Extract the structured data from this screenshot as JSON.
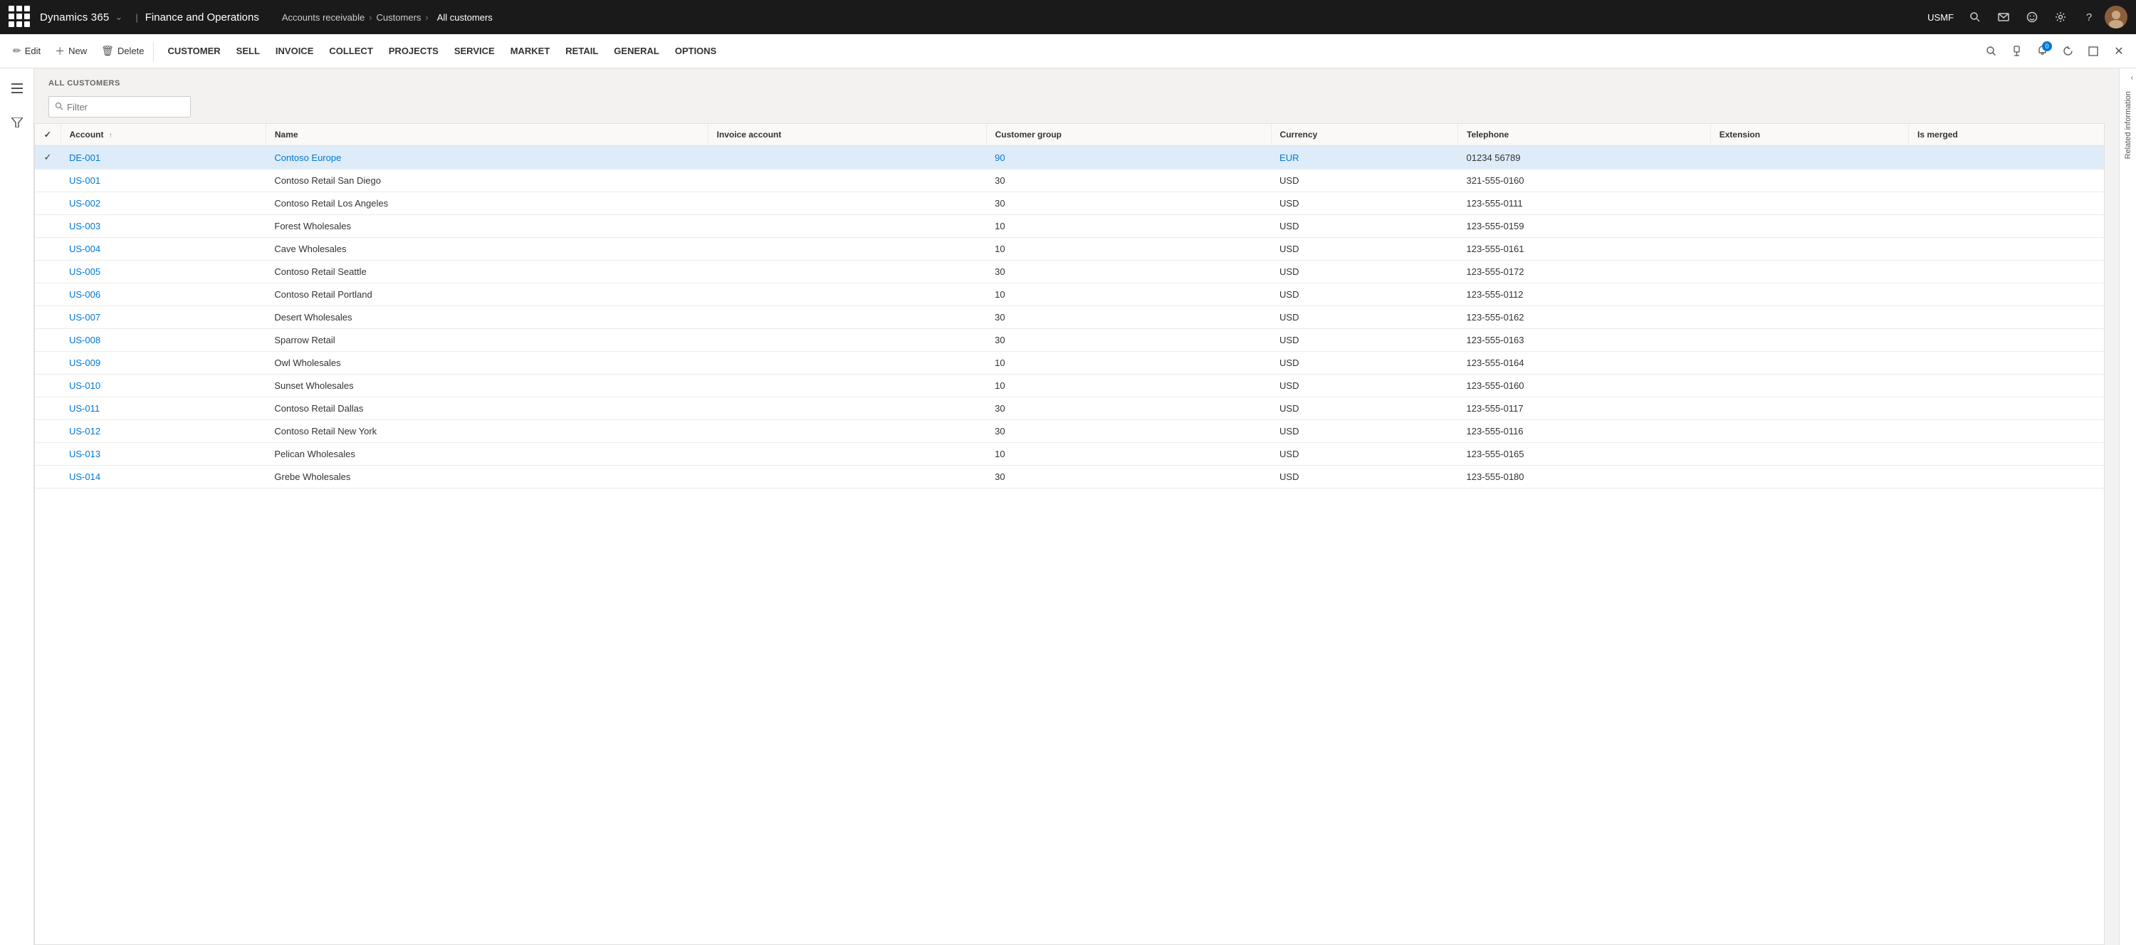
{
  "topNav": {
    "brand_d365": "Dynamics 365",
    "brand_fo": "Finance and Operations",
    "dropdown_arrow": "∨",
    "breadcrumb": [
      {
        "label": "Accounts receivable",
        "href": "#"
      },
      {
        "label": "Customers",
        "href": "#"
      },
      {
        "label": "All customers",
        "href": "#",
        "current": true
      }
    ],
    "company": "USMF",
    "icons": {
      "search": "🔍",
      "chat": "💬",
      "face": "☺",
      "settings": "⚙",
      "help": "?"
    }
  },
  "commandBar": {
    "edit_label": "Edit",
    "new_label": "New",
    "delete_label": "Delete",
    "menus": [
      "CUSTOMER",
      "SELL",
      "INVOICE",
      "COLLECT",
      "PROJECTS",
      "SERVICE",
      "MARKET",
      "RETAIL",
      "GENERAL",
      "OPTIONS"
    ],
    "notification_count": "0"
  },
  "page": {
    "title": "ALL CUSTOMERS",
    "filter_placeholder": "Filter"
  },
  "table": {
    "columns": [
      {
        "key": "account",
        "label": "Account",
        "sortable": true,
        "sorted": true
      },
      {
        "key": "name",
        "label": "Name"
      },
      {
        "key": "invoice_account",
        "label": "Invoice account"
      },
      {
        "key": "customer_group",
        "label": "Customer group"
      },
      {
        "key": "currency",
        "label": "Currency"
      },
      {
        "key": "telephone",
        "label": "Telephone"
      },
      {
        "key": "extension",
        "label": "Extension"
      },
      {
        "key": "is_merged",
        "label": "Is merged"
      }
    ],
    "rows": [
      {
        "account": "DE-001",
        "name": "Contoso Europe",
        "invoice_account": "",
        "customer_group": "90",
        "currency": "EUR",
        "telephone": "01234 56789",
        "extension": "",
        "is_merged": "",
        "selected": true
      },
      {
        "account": "US-001",
        "name": "Contoso Retail San Diego",
        "invoice_account": "",
        "customer_group": "30",
        "currency": "USD",
        "telephone": "321-555-0160",
        "extension": "",
        "is_merged": "",
        "selected": false
      },
      {
        "account": "US-002",
        "name": "Contoso Retail Los Angeles",
        "invoice_account": "",
        "customer_group": "30",
        "currency": "USD",
        "telephone": "123-555-0111",
        "extension": "",
        "is_merged": "",
        "selected": false
      },
      {
        "account": "US-003",
        "name": "Forest Wholesales",
        "invoice_account": "",
        "customer_group": "10",
        "currency": "USD",
        "telephone": "123-555-0159",
        "extension": "",
        "is_merged": "",
        "selected": false
      },
      {
        "account": "US-004",
        "name": "Cave Wholesales",
        "invoice_account": "",
        "customer_group": "10",
        "currency": "USD",
        "telephone": "123-555-0161",
        "extension": "",
        "is_merged": "",
        "selected": false
      },
      {
        "account": "US-005",
        "name": "Contoso Retail Seattle",
        "invoice_account": "",
        "customer_group": "30",
        "currency": "USD",
        "telephone": "123-555-0172",
        "extension": "",
        "is_merged": "",
        "selected": false
      },
      {
        "account": "US-006",
        "name": "Contoso Retail Portland",
        "invoice_account": "",
        "customer_group": "10",
        "currency": "USD",
        "telephone": "123-555-0112",
        "extension": "",
        "is_merged": "",
        "selected": false
      },
      {
        "account": "US-007",
        "name": "Desert Wholesales",
        "invoice_account": "",
        "customer_group": "30",
        "currency": "USD",
        "telephone": "123-555-0162",
        "extension": "",
        "is_merged": "",
        "selected": false
      },
      {
        "account": "US-008",
        "name": "Sparrow Retail",
        "invoice_account": "",
        "customer_group": "30",
        "currency": "USD",
        "telephone": "123-555-0163",
        "extension": "",
        "is_merged": "",
        "selected": false
      },
      {
        "account": "US-009",
        "name": "Owl Wholesales",
        "invoice_account": "",
        "customer_group": "10",
        "currency": "USD",
        "telephone": "123-555-0164",
        "extension": "",
        "is_merged": "",
        "selected": false
      },
      {
        "account": "US-010",
        "name": "Sunset Wholesales",
        "invoice_account": "",
        "customer_group": "10",
        "currency": "USD",
        "telephone": "123-555-0160",
        "extension": "",
        "is_merged": "",
        "selected": false
      },
      {
        "account": "US-011",
        "name": "Contoso Retail Dallas",
        "invoice_account": "",
        "customer_group": "30",
        "currency": "USD",
        "telephone": "123-555-0117",
        "extension": "",
        "is_merged": "",
        "selected": false
      },
      {
        "account": "US-012",
        "name": "Contoso Retail New York",
        "invoice_account": "",
        "customer_group": "30",
        "currency": "USD",
        "telephone": "123-555-0116",
        "extension": "",
        "is_merged": "",
        "selected": false
      },
      {
        "account": "US-013",
        "name": "Pelican Wholesales",
        "invoice_account": "",
        "customer_group": "10",
        "currency": "USD",
        "telephone": "123-555-0165",
        "extension": "",
        "is_merged": "",
        "selected": false
      },
      {
        "account": "US-014",
        "name": "Grebe Wholesales",
        "invoice_account": "",
        "customer_group": "30",
        "currency": "USD",
        "telephone": "123-555-0180",
        "extension": "",
        "is_merged": "",
        "selected": false
      }
    ]
  },
  "rightPanel": {
    "label": "Related information"
  }
}
